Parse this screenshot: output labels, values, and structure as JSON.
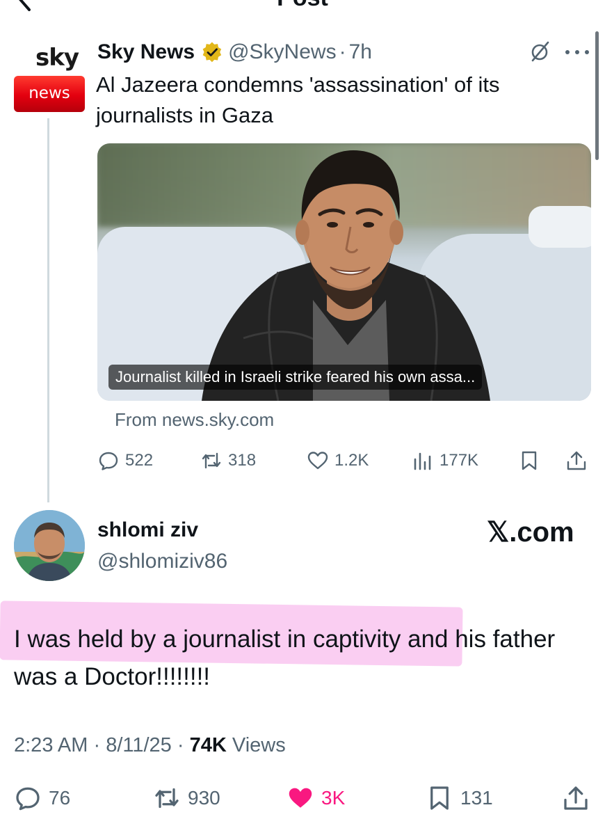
{
  "header": {
    "title": "Post"
  },
  "quoted_post": {
    "author_name": "Sky News",
    "handle": "@SkyNews",
    "separator": "·",
    "time_ago": "7h",
    "text": "Al Jazeera condemns 'assassination' of its journalists in Gaza",
    "logo_sky": "sky",
    "logo_news": "news",
    "card": {
      "caption": "Journalist killed in Israeli strike feared his own assa...",
      "source": "From news.sky.com"
    },
    "stats": {
      "replies": "522",
      "reposts": "318",
      "likes": "1.2K",
      "views": "177K"
    },
    "icons": [
      "verified-badge-icon",
      "grok-icon",
      "more-icon",
      "reply-icon",
      "repost-icon",
      "like-icon",
      "views-icon",
      "bookmark-icon",
      "share-icon"
    ]
  },
  "main_post": {
    "display_name": "shlomi ziv",
    "handle": "@shlomiziv86",
    "watermark": "𝕏.com",
    "text": "I was held by a journalist in captivity and his father was a Doctor!!!!!!!!",
    "time": "2:23 AM",
    "date": "8/11/25",
    "separator": "·",
    "views_count": "74K",
    "views_label": "Views",
    "actions": {
      "replies": "76",
      "reposts": "930",
      "likes": "3K",
      "bookmarks": "131"
    },
    "like_color": "#f91880",
    "highlight_color": "#f9c6f0"
  }
}
